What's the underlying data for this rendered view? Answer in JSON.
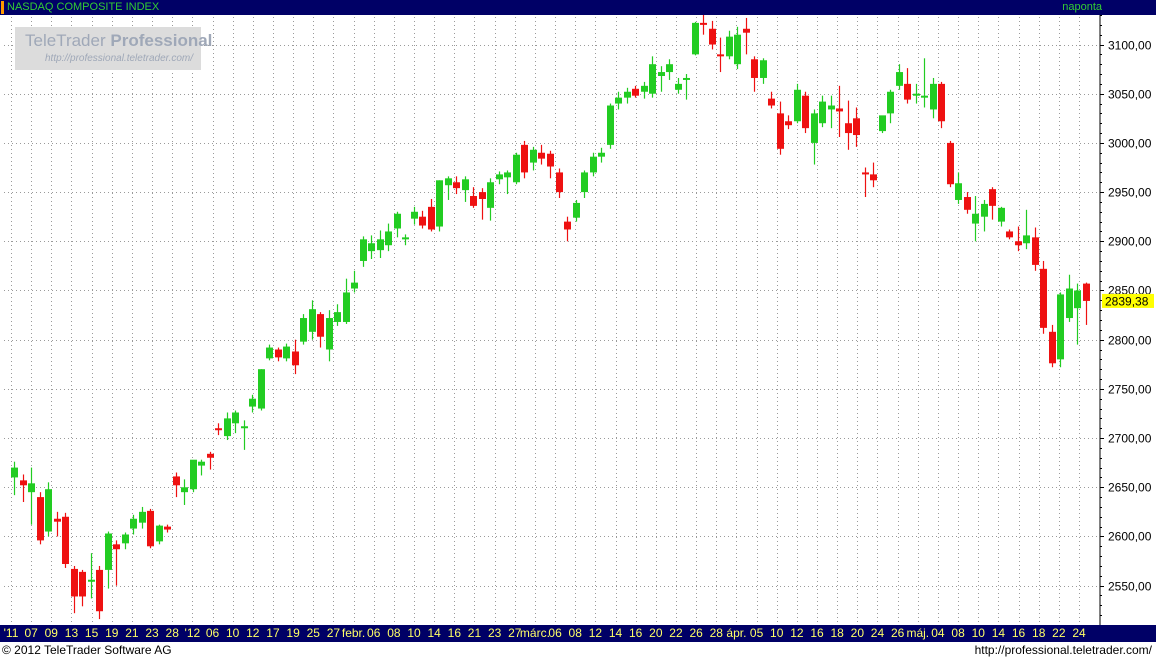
{
  "header": {
    "title": "NASDAQ COMPOSITE INDEX",
    "interval": "naponta"
  },
  "logo": {
    "brand_light": "TeleTrader",
    "brand_bold": "Professional",
    "url": "http://professional.teletrader.com/"
  },
  "footer": {
    "copyright": "© 2012 TeleTrader Software AG",
    "url": "http://professional.teletrader.com/"
  },
  "colors": {
    "up": "#22cc22",
    "down": "#ee1111",
    "background": "#ffffff",
    "header_background": "#000066",
    "header_text": "#33cc33",
    "last_price_background": "#ffff00",
    "grid": "#9a9a9a"
  },
  "chart_data": {
    "type": "candlestick",
    "y_axis": {
      "position": "right",
      "range": [
        2510,
        3130
      ],
      "ticks": [
        2550,
        2600,
        2650,
        2700,
        2750,
        2800,
        2850,
        2900,
        2950,
        3000,
        3050,
        3100
      ],
      "tick_labels": [
        "2550,00",
        "2600,00",
        "2650,00",
        "2700,00",
        "2750,00",
        "2800,00",
        "2850,00",
        "2900,00",
        "2950,00",
        "3000,00",
        "3050,00",
        "3100,00"
      ]
    },
    "x_axis": {
      "tick_labels": [
        "'11",
        "07",
        "09",
        "13",
        "15",
        "19",
        "21",
        "23",
        "28",
        "'12",
        "06",
        "10",
        "12",
        "17",
        "19",
        "25",
        "27",
        "febr.",
        "06",
        "08",
        "10",
        "14",
        "16",
        "21",
        "23",
        "27",
        "márc.",
        "06",
        "08",
        "12",
        "14",
        "16",
        "20",
        "22",
        "26",
        "28",
        "ápr.",
        "05",
        "10",
        "12",
        "16",
        "18",
        "20",
        "24",
        "26",
        "máj.",
        "04",
        "08",
        "10",
        "14",
        "16",
        "18",
        "22",
        "24"
      ]
    },
    "grid": true,
    "last_price": 2839.38,
    "last_price_label": "2839,38",
    "candles": [
      {
        "o": 2660,
        "h": 2676,
        "l": 2642,
        "c": 2670
      },
      {
        "o": 2657,
        "h": 2663,
        "l": 2635,
        "c": 2652
      },
      {
        "o": 2645,
        "h": 2670,
        "l": 2612,
        "c": 2654
      },
      {
        "o": 2640,
        "h": 2645,
        "l": 2592,
        "c": 2596
      },
      {
        "o": 2605,
        "h": 2655,
        "l": 2600,
        "c": 2648
      },
      {
        "o": 2618,
        "h": 2625,
        "l": 2600,
        "c": 2615
      },
      {
        "o": 2620,
        "h": 2624,
        "l": 2568,
        "c": 2572
      },
      {
        "o": 2567,
        "h": 2570,
        "l": 2522,
        "c": 2539
      },
      {
        "o": 2564,
        "h": 2566,
        "l": 2529,
        "c": 2539
      },
      {
        "o": 2555,
        "h": 2583,
        "l": 2537,
        "c": 2556
      },
      {
        "o": 2566,
        "h": 2570,
        "l": 2516,
        "c": 2524
      },
      {
        "o": 2566,
        "h": 2605,
        "l": 2547,
        "c": 2603
      },
      {
        "o": 2592,
        "h": 2596,
        "l": 2550,
        "c": 2587
      },
      {
        "o": 2593,
        "h": 2604,
        "l": 2587,
        "c": 2602
      },
      {
        "o": 2608,
        "h": 2622,
        "l": 2602,
        "c": 2618
      },
      {
        "o": 2614,
        "h": 2630,
        "l": 2608,
        "c": 2625
      },
      {
        "o": 2626,
        "h": 2628,
        "l": 2588,
        "c": 2590
      },
      {
        "o": 2595,
        "h": 2612,
        "l": 2592,
        "c": 2611
      },
      {
        "o": 2610,
        "h": 2612,
        "l": 2604,
        "c": 2607
      },
      {
        "o": 2661,
        "h": 2665,
        "l": 2640,
        "c": 2652
      },
      {
        "o": 2645,
        "h": 2658,
        "l": 2632,
        "c": 2650
      },
      {
        "o": 2648,
        "h": 2670,
        "l": 2645,
        "c": 2678
      },
      {
        "o": 2672,
        "h": 2678,
        "l": 2662,
        "c": 2676
      },
      {
        "o": 2684,
        "h": 2686,
        "l": 2668,
        "c": 2680
      },
      {
        "o": 2710,
        "h": 2715,
        "l": 2703,
        "c": 2708
      },
      {
        "o": 2702,
        "h": 2726,
        "l": 2698,
        "c": 2720
      },
      {
        "o": 2715,
        "h": 2728,
        "l": 2705,
        "c": 2726
      },
      {
        "o": 2712,
        "h": 2718,
        "l": 2688,
        "c": 2712
      },
      {
        "o": 2732,
        "h": 2744,
        "l": 2726,
        "c": 2740
      },
      {
        "o": 2730,
        "h": 2770,
        "l": 2728,
        "c": 2770
      },
      {
        "o": 2781,
        "h": 2795,
        "l": 2779,
        "c": 2792
      },
      {
        "o": 2790,
        "h": 2792,
        "l": 2778,
        "c": 2782
      },
      {
        "o": 2781,
        "h": 2796,
        "l": 2778,
        "c": 2793
      },
      {
        "o": 2788,
        "h": 2800,
        "l": 2765,
        "c": 2774
      },
      {
        "o": 2798,
        "h": 2826,
        "l": 2795,
        "c": 2822
      },
      {
        "o": 2808,
        "h": 2840,
        "l": 2800,
        "c": 2831
      },
      {
        "o": 2826,
        "h": 2828,
        "l": 2792,
        "c": 2803
      },
      {
        "o": 2790,
        "h": 2830,
        "l": 2778,
        "c": 2822
      },
      {
        "o": 2818,
        "h": 2836,
        "l": 2814,
        "c": 2828
      },
      {
        "o": 2818,
        "h": 2862,
        "l": 2816,
        "c": 2848
      },
      {
        "o": 2852,
        "h": 2870,
        "l": 2848,
        "c": 2858
      },
      {
        "o": 2880,
        "h": 2905,
        "l": 2874,
        "c": 2902
      },
      {
        "o": 2890,
        "h": 2906,
        "l": 2882,
        "c": 2898
      },
      {
        "o": 2891,
        "h": 2911,
        "l": 2883,
        "c": 2902
      },
      {
        "o": 2896,
        "h": 2918,
        "l": 2890,
        "c": 2910
      },
      {
        "o": 2913,
        "h": 2930,
        "l": 2904,
        "c": 2928
      },
      {
        "o": 2902,
        "h": 2907,
        "l": 2896,
        "c": 2904
      },
      {
        "o": 2923,
        "h": 2935,
        "l": 2917,
        "c": 2930
      },
      {
        "o": 2925,
        "h": 2931,
        "l": 2913,
        "c": 2916
      },
      {
        "o": 2935,
        "h": 2943,
        "l": 2910,
        "c": 2912
      },
      {
        "o": 2915,
        "h": 2962,
        "l": 2910,
        "c": 2962
      },
      {
        "o": 2957,
        "h": 2966,
        "l": 2942,
        "c": 2964
      },
      {
        "o": 2960,
        "h": 2966,
        "l": 2948,
        "c": 2954
      },
      {
        "o": 2952,
        "h": 2966,
        "l": 2940,
        "c": 2963
      },
      {
        "o": 2946,
        "h": 2955,
        "l": 2934,
        "c": 2936
      },
      {
        "o": 2950,
        "h": 2954,
        "l": 2922,
        "c": 2943
      },
      {
        "o": 2934,
        "h": 2964,
        "l": 2921,
        "c": 2960
      },
      {
        "o": 2963,
        "h": 2971,
        "l": 2958,
        "c": 2968
      },
      {
        "o": 2965,
        "h": 2972,
        "l": 2948,
        "c": 2970
      },
      {
        "o": 2960,
        "h": 2990,
        "l": 2958,
        "c": 2988
      },
      {
        "o": 2998,
        "h": 3002,
        "l": 2964,
        "c": 2970
      },
      {
        "o": 2980,
        "h": 2996,
        "l": 2972,
        "c": 2993
      },
      {
        "o": 2990,
        "h": 2998,
        "l": 2978,
        "c": 2984
      },
      {
        "o": 2989,
        "h": 2992,
        "l": 2964,
        "c": 2976
      },
      {
        "o": 2970,
        "h": 2974,
        "l": 2944,
        "c": 2950
      },
      {
        "o": 2920,
        "h": 2925,
        "l": 2900,
        "c": 2912
      },
      {
        "o": 2924,
        "h": 2942,
        "l": 2920,
        "c": 2939
      },
      {
        "o": 2950,
        "h": 2972,
        "l": 2944,
        "c": 2970
      },
      {
        "o": 2970,
        "h": 2990,
        "l": 2966,
        "c": 2986
      },
      {
        "o": 2986,
        "h": 2995,
        "l": 2980,
        "c": 2990
      },
      {
        "o": 2998,
        "h": 3040,
        "l": 2994,
        "c": 3038
      },
      {
        "o": 3040,
        "h": 3052,
        "l": 3034,
        "c": 3046
      },
      {
        "o": 3046,
        "h": 3056,
        "l": 3040,
        "c": 3052
      },
      {
        "o": 3055,
        "h": 3058,
        "l": 3046,
        "c": 3048
      },
      {
        "o": 3052,
        "h": 3062,
        "l": 3045,
        "c": 3058
      },
      {
        "o": 3050,
        "h": 3088,
        "l": 3046,
        "c": 3080
      },
      {
        "o": 3068,
        "h": 3078,
        "l": 3052,
        "c": 3072
      },
      {
        "o": 3072,
        "h": 3085,
        "l": 3064,
        "c": 3080
      },
      {
        "o": 3054,
        "h": 3066,
        "l": 3050,
        "c": 3060
      },
      {
        "o": 3064,
        "h": 3070,
        "l": 3044,
        "c": 3066
      },
      {
        "o": 3090,
        "h": 3123,
        "l": 3089,
        "c": 3122
      },
      {
        "o": 3122,
        "h": 3134,
        "l": 3110,
        "c": 3120
      },
      {
        "o": 3116,
        "h": 3124,
        "l": 3095,
        "c": 3100
      },
      {
        "o": 3090,
        "h": 3107,
        "l": 3072,
        "c": 3088
      },
      {
        "o": 3088,
        "h": 3114,
        "l": 3085,
        "c": 3108
      },
      {
        "o": 3080,
        "h": 3118,
        "l": 3075,
        "c": 3110
      },
      {
        "o": 3116,
        "h": 3127,
        "l": 3090,
        "c": 3112
      },
      {
        "o": 3085,
        "h": 3088,
        "l": 3052,
        "c": 3066
      },
      {
        "o": 3066,
        "h": 3086,
        "l": 3060,
        "c": 3084
      },
      {
        "o": 3045,
        "h": 3052,
        "l": 3035,
        "c": 3038
      },
      {
        "o": 3030,
        "h": 3042,
        "l": 2988,
        "c": 2994
      },
      {
        "o": 3022,
        "h": 3028,
        "l": 3014,
        "c": 3018
      },
      {
        "o": 3022,
        "h": 3060,
        "l": 3020,
        "c": 3054
      },
      {
        "o": 3048,
        "h": 3052,
        "l": 3010,
        "c": 3015
      },
      {
        "o": 3000,
        "h": 3034,
        "l": 2978,
        "c": 3030
      },
      {
        "o": 3020,
        "h": 3048,
        "l": 3016,
        "c": 3042
      },
      {
        "o": 3034,
        "h": 3048,
        "l": 3015,
        "c": 3038
      },
      {
        "o": 3035,
        "h": 3058,
        "l": 3006,
        "c": 3032
      },
      {
        "o": 3020,
        "h": 3043,
        "l": 2993,
        "c": 3010
      },
      {
        "o": 3025,
        "h": 3036,
        "l": 2996,
        "c": 3008
      },
      {
        "o": 2970,
        "h": 2975,
        "l": 2945,
        "c": 2968
      },
      {
        "o": 2968,
        "h": 2980,
        "l": 2955,
        "c": 2962
      },
      {
        "o": 3012,
        "h": 3026,
        "l": 3010,
        "c": 3028
      },
      {
        "o": 3030,
        "h": 3054,
        "l": 3020,
        "c": 3052
      },
      {
        "o": 3058,
        "h": 3080,
        "l": 3054,
        "c": 3072
      },
      {
        "o": 3060,
        "h": 3076,
        "l": 3040,
        "c": 3044
      },
      {
        "o": 3048,
        "h": 3060,
        "l": 3040,
        "c": 3050
      },
      {
        "o": 3046,
        "h": 3086,
        "l": 3036,
        "c": 3048
      },
      {
        "o": 3034,
        "h": 3066,
        "l": 3025,
        "c": 3060
      },
      {
        "o": 3060,
        "h": 3062,
        "l": 3015,
        "c": 3022
      },
      {
        "o": 3000,
        "h": 3002,
        "l": 2955,
        "c": 2958
      },
      {
        "o": 2942,
        "h": 2970,
        "l": 2938,
        "c": 2959
      },
      {
        "o": 2945,
        "h": 2950,
        "l": 2928,
        "c": 2932
      },
      {
        "o": 2918,
        "h": 2946,
        "l": 2900,
        "c": 2928
      },
      {
        "o": 2925,
        "h": 2942,
        "l": 2910,
        "c": 2938
      },
      {
        "o": 2953,
        "h": 2955,
        "l": 2922,
        "c": 2936
      },
      {
        "o": 2920,
        "h": 2935,
        "l": 2915,
        "c": 2934
      },
      {
        "o": 2910,
        "h": 2912,
        "l": 2902,
        "c": 2904
      },
      {
        "o": 2900,
        "h": 2915,
        "l": 2890,
        "c": 2896
      },
      {
        "o": 2898,
        "h": 2932,
        "l": 2892,
        "c": 2906
      },
      {
        "o": 2904,
        "h": 2914,
        "l": 2870,
        "c": 2876
      },
      {
        "o": 2872,
        "h": 2880,
        "l": 2806,
        "c": 2812
      },
      {
        "o": 2808,
        "h": 2815,
        "l": 2772,
        "c": 2776
      },
      {
        "o": 2780,
        "h": 2848,
        "l": 2772,
        "c": 2846
      },
      {
        "o": 2822,
        "h": 2866,
        "l": 2818,
        "c": 2852
      },
      {
        "o": 2832,
        "h": 2857,
        "l": 2795,
        "c": 2850
      },
      {
        "o": 2857,
        "h": 2858,
        "l": 2815,
        "c": 2839.38
      }
    ]
  }
}
